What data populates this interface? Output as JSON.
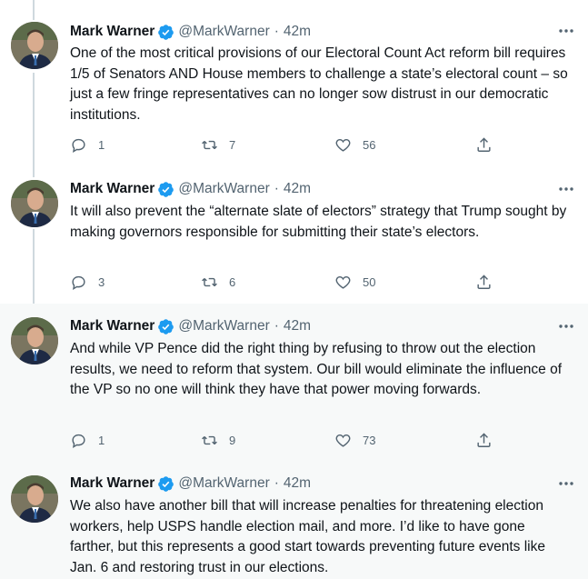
{
  "author": {
    "name": "Mark Warner",
    "handle": "@MarkWarner",
    "separator": "·",
    "verified": true,
    "avatar_desc": "profile-photo"
  },
  "colors": {
    "verified": "#1d9bf0",
    "muted": "#536471",
    "text": "#0f1419",
    "thread_line": "#cfd9de"
  },
  "tweets": [
    {
      "time": "42m",
      "text": "One of the most critical provisions of our Electoral Count Act reform bill requires 1/5 of Senators AND House members to challenge a state’s electoral count – so just a few fringe representatives can no longer sow distrust in our democratic institutions.",
      "replies": "1",
      "retweets": "7",
      "likes": "56"
    },
    {
      "time": "42m",
      "text": "It will also prevent the “alternate slate of electors” strategy that Trump sought by making governors responsible for submitting their state’s electors.",
      "replies": "3",
      "retweets": "6",
      "likes": "50"
    },
    {
      "time": "42m",
      "text": "And while VP Pence did the right thing by refusing to throw out the election results, we need to reform that system. Our bill would eliminate the influence of the VP so no one will think they have that power moving forwards.",
      "replies": "1",
      "retweets": "9",
      "likes": "73"
    },
    {
      "time": "42m",
      "text": "We also have another bill that will increase penalties for threatening election workers, help USPS handle election mail, and more. I’d like to have gone farther, but this represents a good start towards preventing future events like Jan. 6 and restoring trust in our elections."
    }
  ]
}
